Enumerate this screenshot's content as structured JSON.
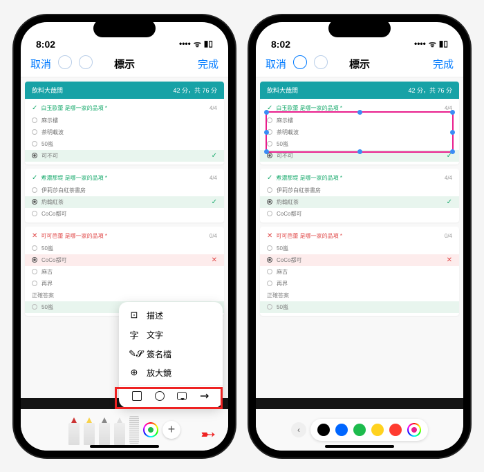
{
  "status": {
    "time": "8:02",
    "signal": "●●●●",
    "wifi": "⬩",
    "battery": "▮▮"
  },
  "nav": {
    "cancel": "取消",
    "title": "標示",
    "done": "完成"
  },
  "quiz": {
    "header_title": "飲料大哉問",
    "header_score": "42 分，共 76 分",
    "q1": {
      "title": "白玉歐蕾 是哪一家的品項 *",
      "score": "4/4",
      "options": [
        "麻示樓",
        "茶明載波",
        "50嵐",
        "可不可"
      ],
      "selected_index": 3
    },
    "q2": {
      "title": "煮濃那堤 是哪一家的品項 *",
      "score": "4/4",
      "options": [
        "伊莉莎白紅茶書房",
        "約翰紅茶",
        "CoCo都可"
      ],
      "selected_index": 1
    },
    "q3": {
      "title": "可可芭蕾 是哪一家的品項 *",
      "score": "0/4",
      "options": [
        "50嵐",
        "CoCo都可",
        "麻古",
        "再界",
        "50嵐"
      ],
      "selected_index": 1,
      "answer_label": "正確答案"
    }
  },
  "popup": {
    "items": [
      {
        "icon": "⊡",
        "label": "描述"
      },
      {
        "icon": "字",
        "label": "文字"
      },
      {
        "icon": "✎",
        "label": "簽名檔"
      },
      {
        "icon": "⊕",
        "label": "放大鏡"
      }
    ]
  },
  "colors": {
    "swatches": [
      "#000000",
      "#0066ff",
      "#1dbb4d",
      "#ffd21f",
      "#ff3b30"
    ],
    "selected_hex": "#e91e8c"
  }
}
